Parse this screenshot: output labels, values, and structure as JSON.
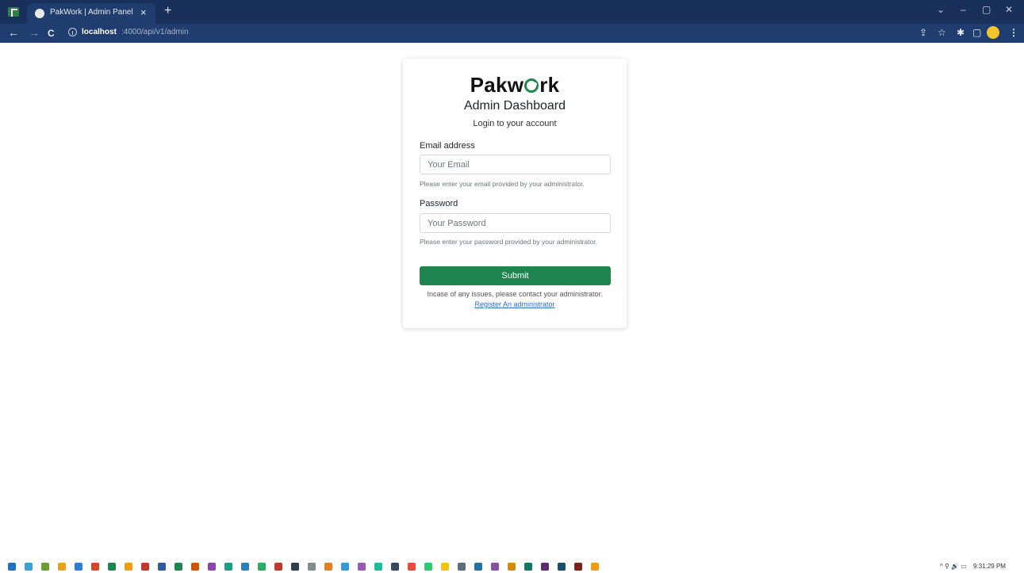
{
  "browser": {
    "tab_title": "PakWork | Admin Panel",
    "tab_close": "×",
    "new_tab": "+",
    "url_host": "localhost",
    "url_path": ":4000/api/v1/admin",
    "back": "←",
    "forward": "→",
    "reload": "C",
    "window_minimize": "–",
    "window_restore": "▢",
    "window_close": "✕",
    "tab_search": "⌄",
    "share_icon": "⇪",
    "star_icon": "☆",
    "extensions_icon": "✱",
    "sidepanel_icon": "▢",
    "menu_icon": "⋮"
  },
  "login": {
    "logo_prefix": "Pakw",
    "logo_suffix": "rk",
    "title": "Admin Dashboard",
    "subtitle": "Login to your account",
    "email_label": "Email address",
    "email_placeholder": "Your Email",
    "email_help": "Please enter your email provided by your administrator.",
    "password_label": "Password",
    "password_placeholder": "Your Password",
    "password_help": "Please enter your password provided by your administrator.",
    "submit_label": "Submit",
    "issue_note": "Incase of any issues, please contact your administrator.",
    "register_link": "Register An administrator"
  },
  "colors": {
    "brand_green": "#1e8550",
    "link_blue": "#2f6ec4",
    "chrome_dark": "#19305a"
  },
  "taskbar": {
    "time": "9:31:29 PM",
    "tray_icons": "^ ⚲ 🔊 ▭",
    "apps": [
      "#1e73be",
      "#3aa0d8",
      "#6a9e2f",
      "#e8a317",
      "#2d7fd3",
      "#d24726",
      "#1e8550",
      "#f39c12",
      "#c0392b",
      "#2c5aa0",
      "#1e8550",
      "#d35400",
      "#8e44ad",
      "#16a085",
      "#2980b9",
      "#27ae60",
      "#c0392b",
      "#2c3e50",
      "#7f8c8d",
      "#e67e22",
      "#3498db",
      "#9b59b6",
      "#1abc9c",
      "#34495e",
      "#e74c3c",
      "#2ecc71",
      "#f1c40f",
      "#5d6d7e",
      "#2471a3",
      "#884ea0",
      "#d68910",
      "#117a65",
      "#5b2c6f",
      "#1b4f72",
      "#7b241c",
      "#f39c12"
    ]
  }
}
